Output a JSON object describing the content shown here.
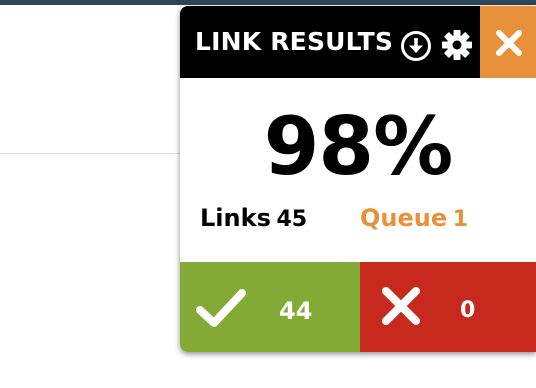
{
  "panel": {
    "title": "LINK RESULTS",
    "percent": "98%",
    "stats": {
      "links_label": "Links",
      "links_value": "45",
      "queue_label": "Queue",
      "queue_value": "1"
    },
    "results": {
      "success_count": "44",
      "fail_count": "0"
    }
  },
  "icons": {
    "download": "download-circle-icon",
    "settings": "gear-icon",
    "close": "close-icon",
    "success": "check-icon",
    "fail": "x-icon"
  },
  "colors": {
    "header": "#000000",
    "accent": "#e8913a",
    "success": "#84aa36",
    "fail": "#c7291c",
    "top_strip": "#2d4652"
  }
}
